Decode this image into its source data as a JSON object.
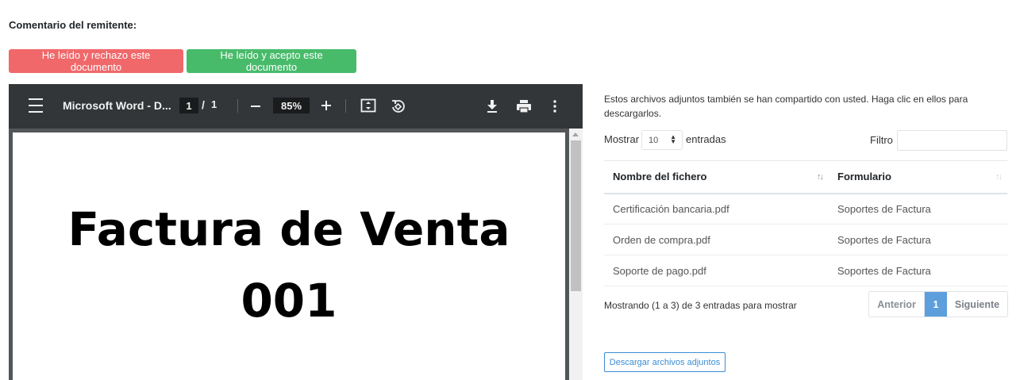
{
  "comment": {
    "label": "Comentario del remitente:"
  },
  "actions": {
    "reject_label": "He leído y rechazo este documento",
    "accept_label": "He leído y acepto este documento",
    "reject_color": "#f0686a",
    "accept_color": "#48bb6b"
  },
  "pdf_viewer": {
    "title": "Microsoft Word - D...",
    "current_page": "1",
    "page_separator": "/",
    "total_pages": "1",
    "zoom_level": "85%",
    "zoom_out_icon": "minus-icon",
    "zoom_in_icon": "plus-icon",
    "document_heading_line1": "Factura de Venta",
    "document_heading_line2": "001"
  },
  "attachments": {
    "intro": "Estos archivos adjuntos también se han compartido con usted. Haga clic en ellos para descargarlos.",
    "show_label": "Mostrar",
    "entries_value": "10",
    "entries_label": "entradas",
    "filter_label": "Filtro",
    "filter_value": "",
    "columns": [
      "Nombre del fichero",
      "Formulario"
    ],
    "rows": [
      {
        "file": "Certificación bancaria.pdf",
        "form": "Soportes de Factura"
      },
      {
        "file": "Orden de compra.pdf",
        "form": "Soportes de Factura"
      },
      {
        "file": "Soporte de pago.pdf",
        "form": "Soportes de Factura"
      }
    ],
    "info": "Mostrando (1 a 3) de 3 entradas para mostrar",
    "pagination": {
      "previous": "Anterior",
      "current": "1",
      "next": "Siguiente"
    },
    "download_all_label": "Descargar archivos adjuntos",
    "accent_color": "#5d9fdc"
  }
}
